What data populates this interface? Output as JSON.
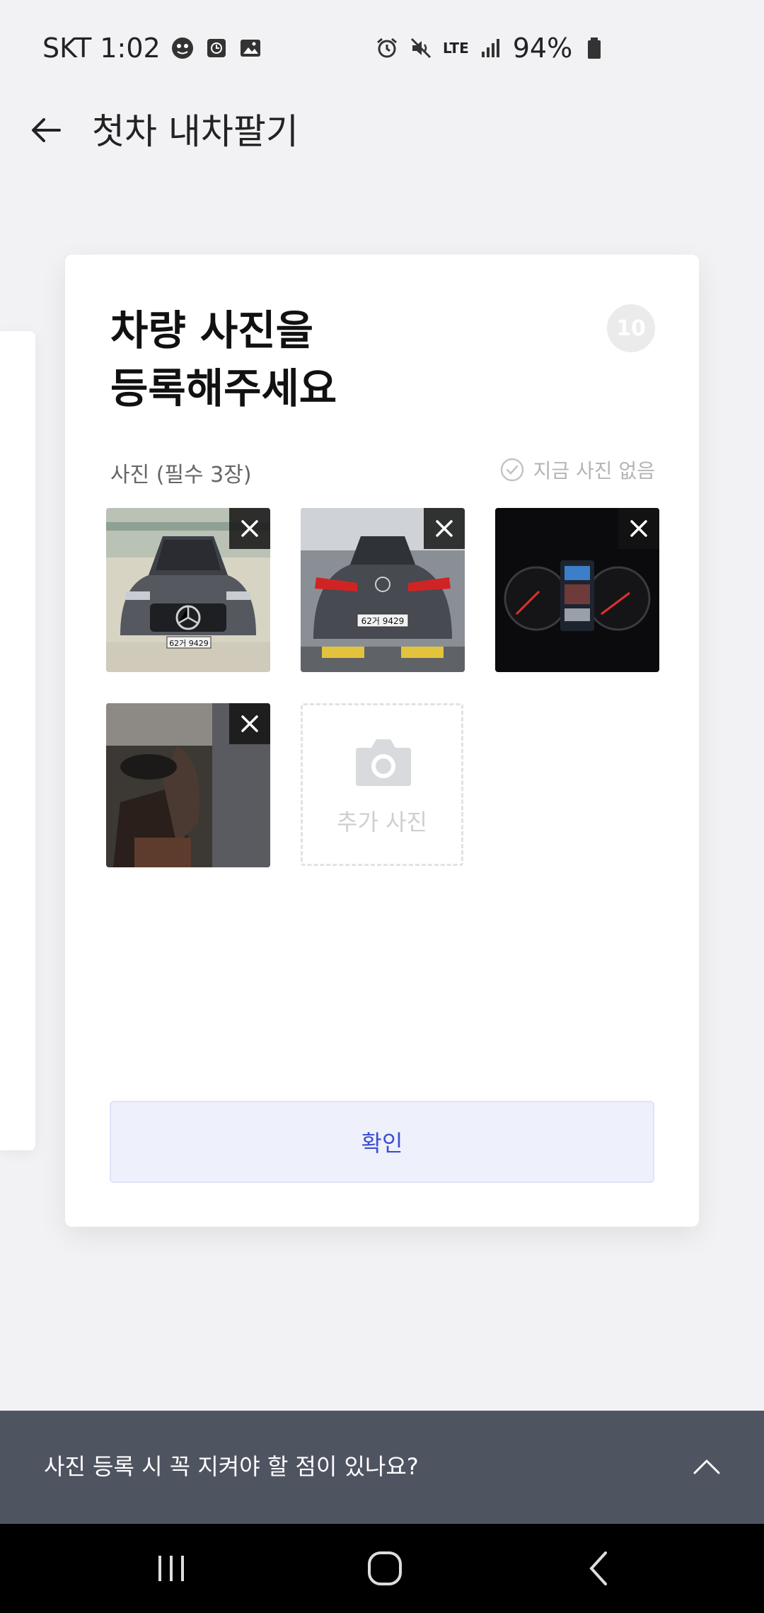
{
  "status_bar": {
    "carrier_time": "SKT 1:02",
    "network": "LTE",
    "battery": "94%"
  },
  "app_bar": {
    "title": "첫차 내차팔기",
    "back_icon": "arrow-left-icon"
  },
  "card": {
    "title": "차량 사진을\n등록해주세요",
    "step": "10",
    "photo_label": "사진 (필수 3장)",
    "no_photo_label": "지금 사진 없음",
    "photos": [
      {
        "subject": "front",
        "plate": "62거 9429"
      },
      {
        "subject": "rear",
        "plate": "62거 9429"
      },
      {
        "subject": "dashboard"
      },
      {
        "subject": "interior"
      }
    ],
    "add_photo_label": "추가 사진",
    "confirm_label": "확인"
  },
  "info_bar": {
    "text": "사진 등록 시 꼭 지켜야 할 점이 있나요?",
    "icon": "chevron-up-icon"
  },
  "colors": {
    "accent": "#3a4fd0",
    "confirm_bg": "#eef0fc",
    "info_bar_bg": "#4f5461",
    "page_bg": "#f2f2f4"
  }
}
